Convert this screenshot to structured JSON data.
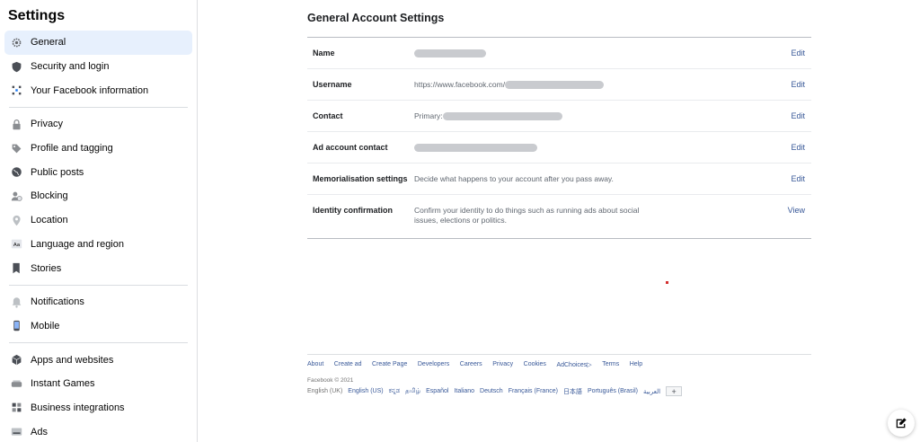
{
  "sidebar": {
    "title": "Settings",
    "groups": [
      [
        {
          "label": "General",
          "icon": "gear-icon",
          "active": true
        },
        {
          "label": "Security and login",
          "icon": "shield-icon"
        },
        {
          "label": "Your Facebook information",
          "icon": "grid-icon"
        }
      ],
      [
        {
          "label": "Privacy",
          "icon": "lock-icon"
        },
        {
          "label": "Profile and tagging",
          "icon": "tag-icon"
        },
        {
          "label": "Public posts",
          "icon": "globe-icon"
        },
        {
          "label": "Blocking",
          "icon": "block-user-icon"
        },
        {
          "label": "Location",
          "icon": "location-pin-icon"
        },
        {
          "label": "Language and region",
          "icon": "language-icon"
        },
        {
          "label": "Stories",
          "icon": "book-icon"
        }
      ],
      [
        {
          "label": "Notifications",
          "icon": "bell-icon"
        },
        {
          "label": "Mobile",
          "icon": "mobile-icon"
        }
      ],
      [
        {
          "label": "Apps and websites",
          "icon": "cube-icon"
        },
        {
          "label": "Instant Games",
          "icon": "gamepad-icon"
        },
        {
          "label": "Business integrations",
          "icon": "puzzle-icon"
        },
        {
          "label": "Ads",
          "icon": "ads-icon"
        }
      ]
    ]
  },
  "main": {
    "title": "General Account Settings",
    "rows": [
      {
        "label": "Name",
        "value": "",
        "action": "Edit"
      },
      {
        "label": "Username",
        "value": "https://www.facebook.com/",
        "action": "Edit"
      },
      {
        "label": "Contact",
        "value": "Primary:",
        "action": "Edit"
      },
      {
        "label": "Ad account contact",
        "value": "",
        "action": "Edit"
      },
      {
        "label": "Memorialisation settings",
        "value": "Decide what happens to your account after you pass away.",
        "action": "Edit"
      },
      {
        "label": "Identity confirmation",
        "value": "Confirm your identity to do things such as running ads about social issues, elections or politics.",
        "action": "View"
      }
    ]
  },
  "footer": {
    "links": [
      "About",
      "Create ad",
      "Create Page",
      "Developers",
      "Careers",
      "Privacy",
      "Cookies",
      "AdChoices▷",
      "Terms",
      "Help"
    ],
    "copyright": "Facebook © 2021",
    "current_language": "English (UK)",
    "languages": [
      "English (US)",
      "ಕನ್ನಡ",
      "தமிழ்",
      "Español",
      "Italiano",
      "Deutsch",
      "Français (France)",
      "日本語",
      "Português (Brasil)",
      "العربية"
    ],
    "more_label": "+"
  },
  "colors": {
    "link": "#385898",
    "active_bg": "#e7f0fd",
    "border": "#dddfe2"
  }
}
